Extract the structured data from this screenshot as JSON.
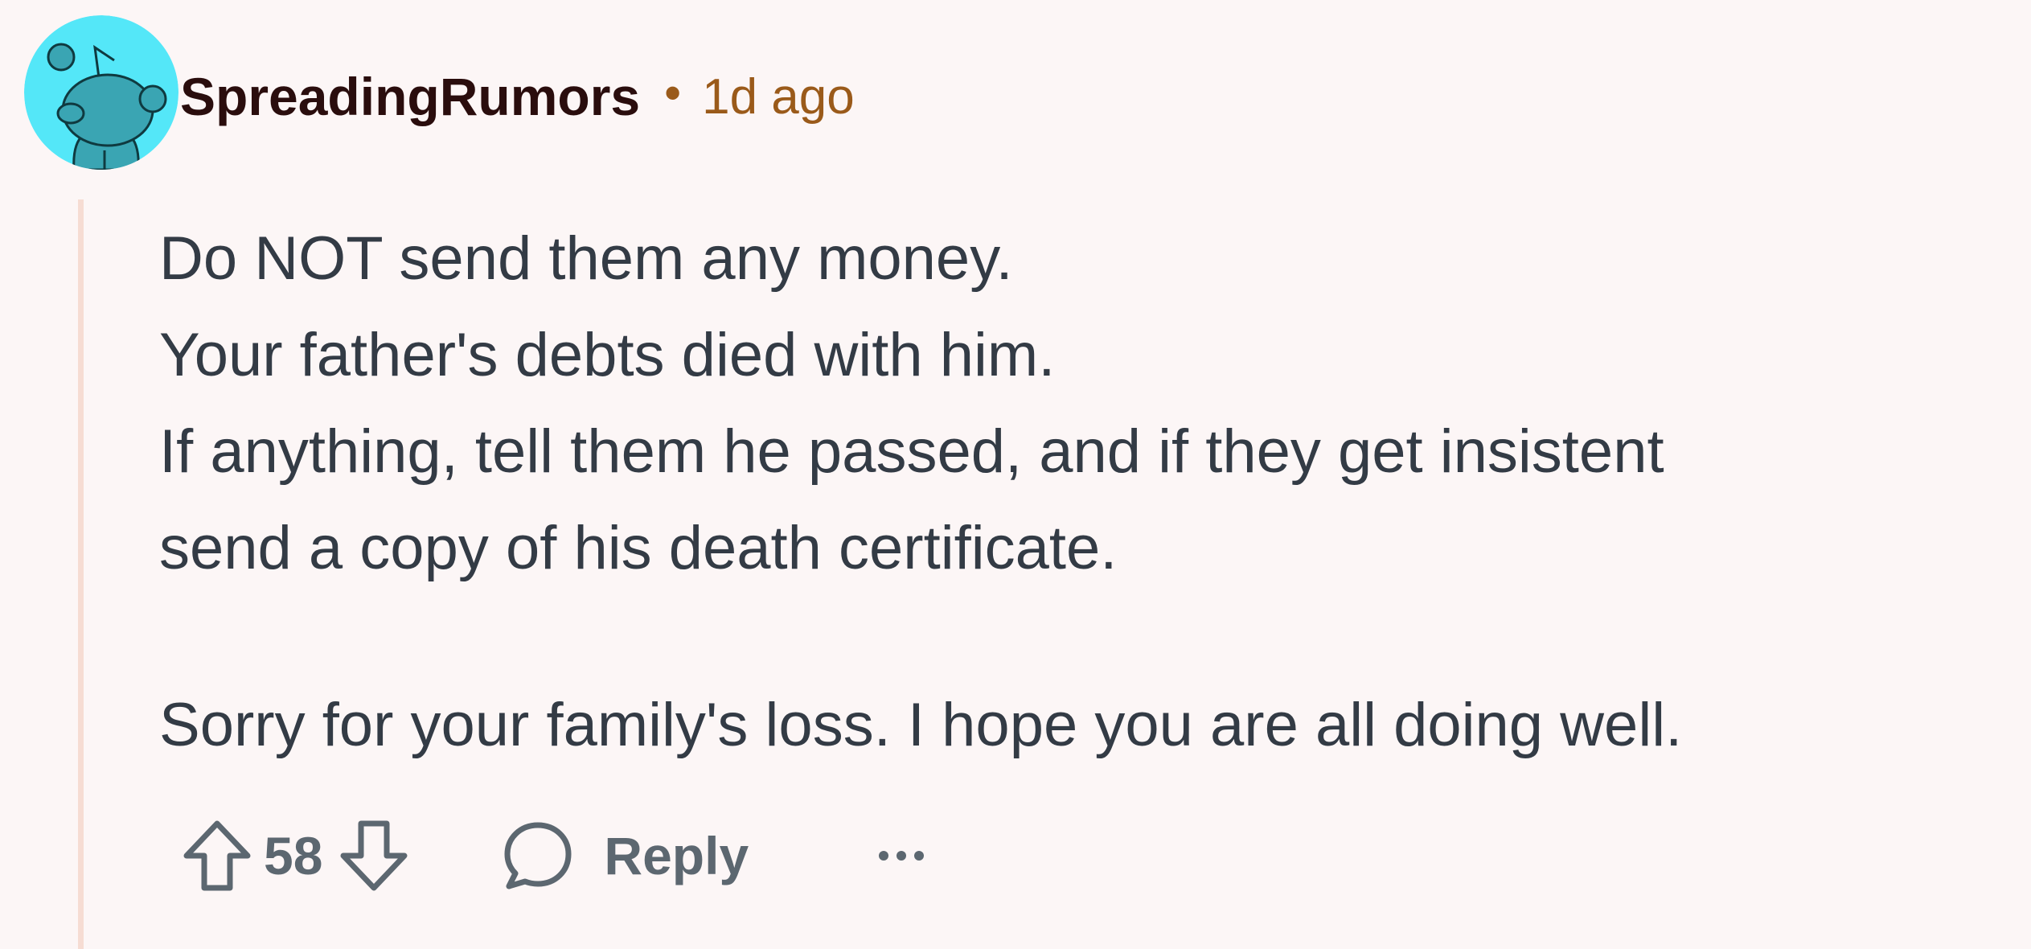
{
  "comment": {
    "author": "SpreadingRumors",
    "separator": "•",
    "time_ago": "1d ago",
    "body_lines": [
      "Do NOT send them any money.",
      "Your father's debts died with him.",
      "If anything, tell them he passed, and if they get insistent",
      "send a copy of his death certificate.",
      "Sorry for your family's loss. I hope you are all doing well."
    ],
    "score": "58",
    "reply_label": "Reply"
  },
  "icons": {
    "avatar": "snoo-avatar-icon",
    "upvote": "arrow-up-icon",
    "downvote": "arrow-down-icon",
    "reply": "speech-bubble-icon",
    "more": "ellipsis-icon"
  },
  "colors": {
    "background": "#fcf6f6",
    "username": "#2a0d0d",
    "timestamp": "#9a5a1a",
    "body_text": "#333b45",
    "action_gray": "#5c6770",
    "thread_line": "#f6dcd3",
    "avatar_bg": "#54e7f8",
    "avatar_figure": "#3aa5b3"
  }
}
